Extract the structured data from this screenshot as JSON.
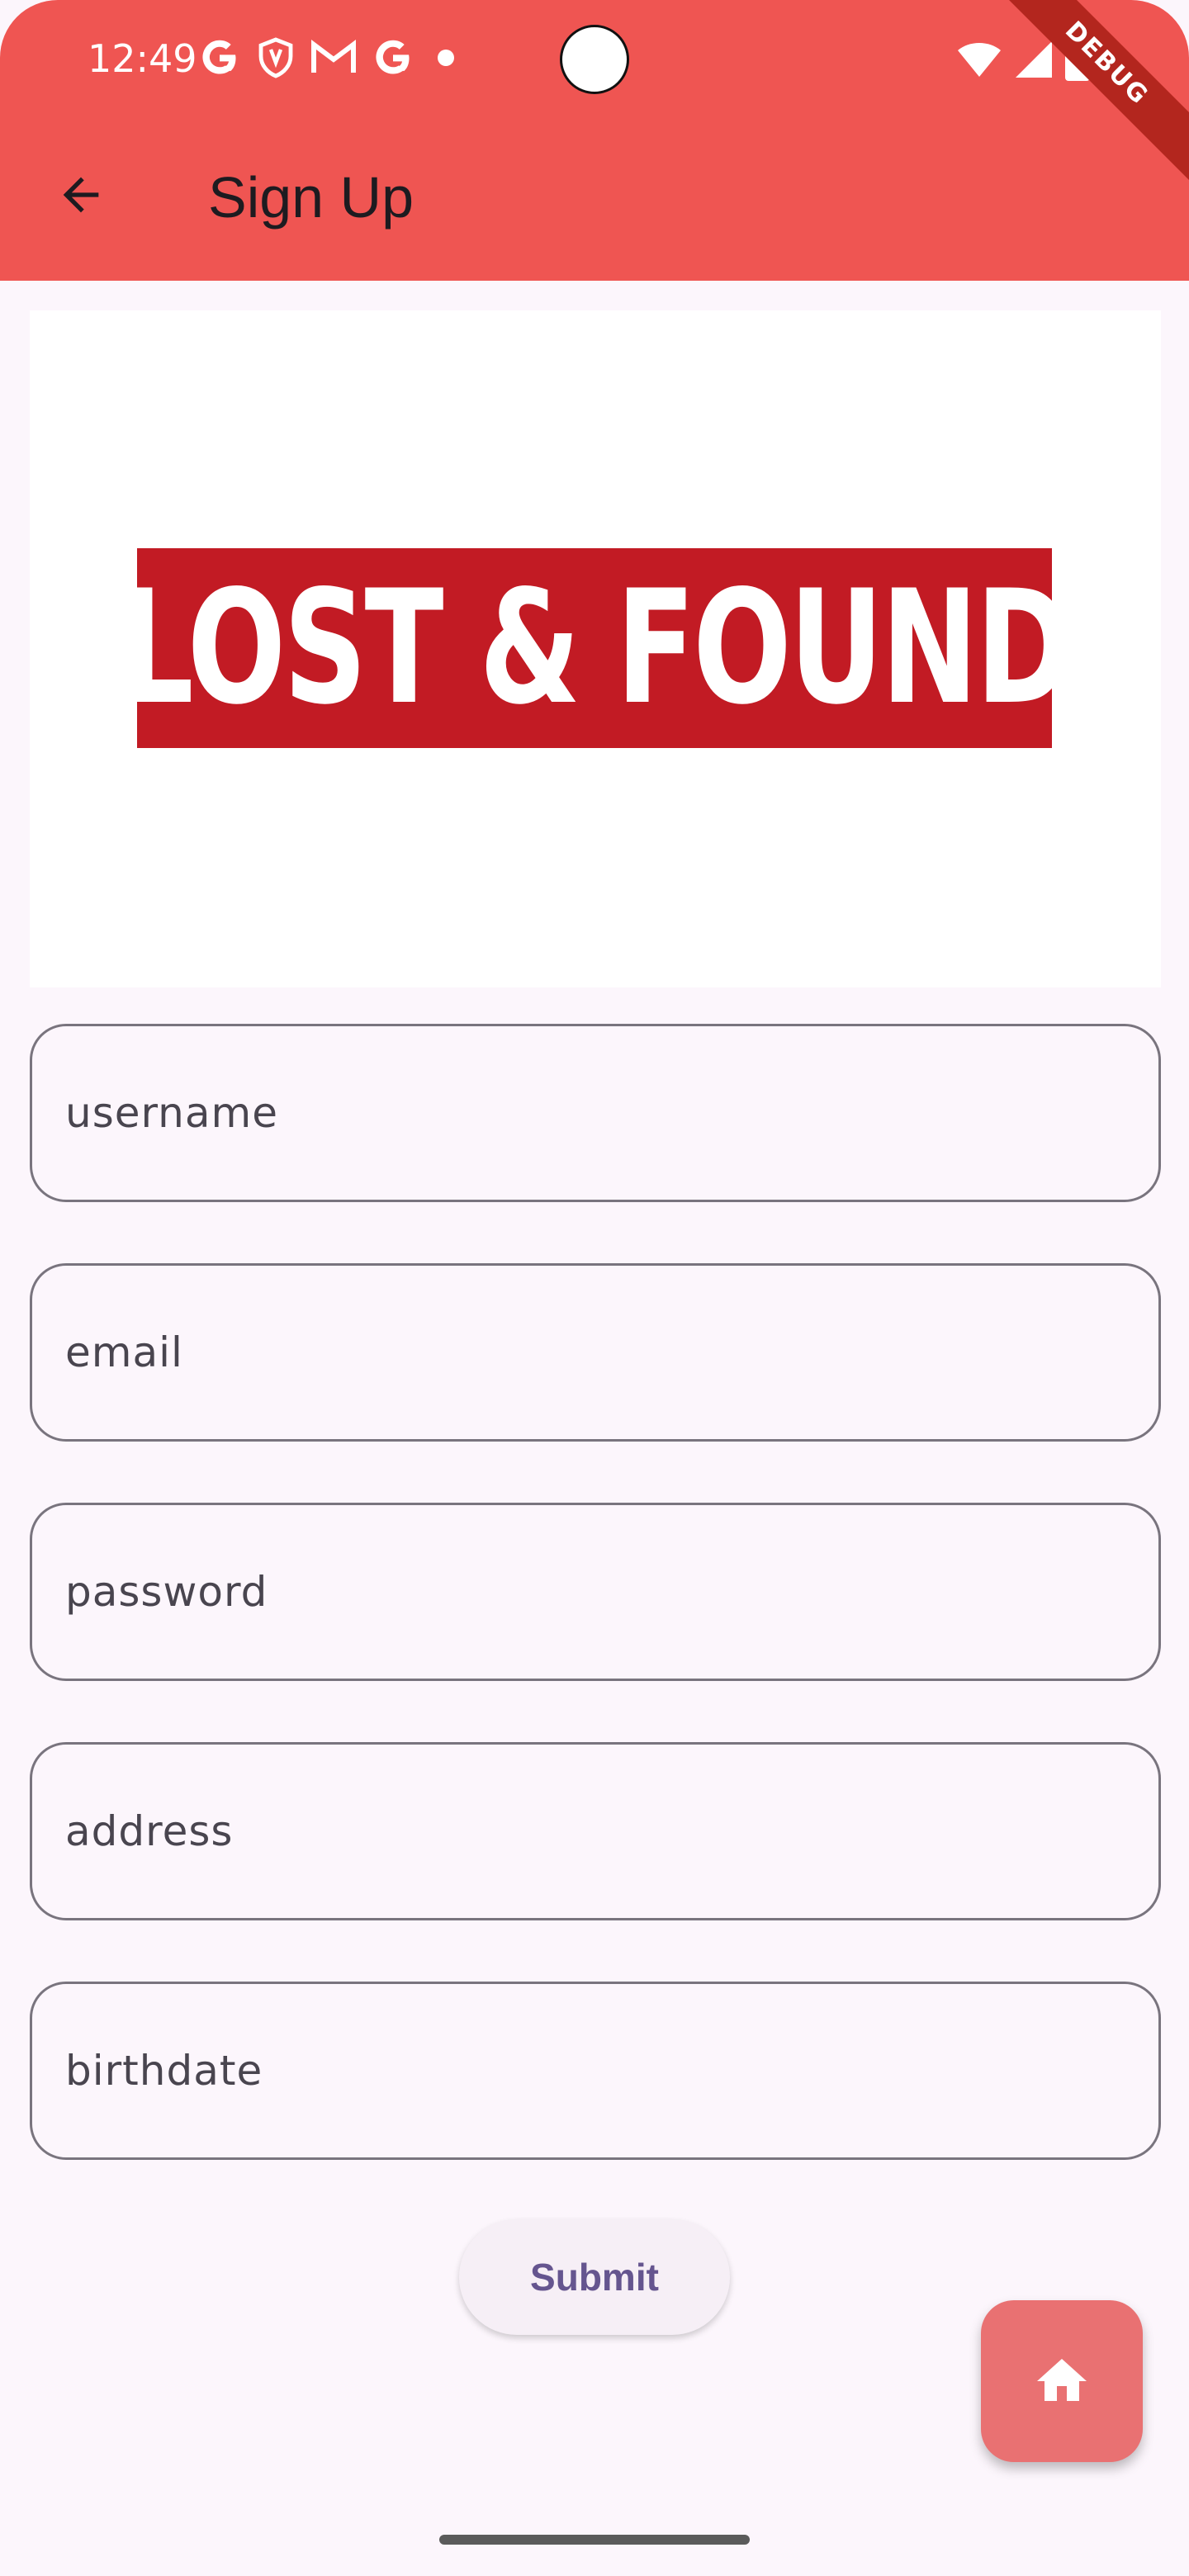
{
  "status_bar": {
    "time": "12:49",
    "icons_left": [
      "google-g-icon",
      "shield-icon",
      "gmail-icon",
      "google-g-icon",
      "dot-icon"
    ],
    "icons_right": [
      "wifi-icon",
      "signal-icon",
      "battery-icon"
    ],
    "debug_label": "DEBUG"
  },
  "app_bar": {
    "title": "Sign Up",
    "background_color": "#ef5552"
  },
  "logo": {
    "text": "LOST & FOUND",
    "banner_color": "#c21b24"
  },
  "form": {
    "fields": [
      {
        "name": "username",
        "placeholder": "username",
        "value": ""
      },
      {
        "name": "email",
        "placeholder": "email",
        "value": ""
      },
      {
        "name": "password",
        "placeholder": "password",
        "value": ""
      },
      {
        "name": "address",
        "placeholder": "address",
        "value": ""
      },
      {
        "name": "birthdate",
        "placeholder": "birthdate",
        "value": ""
      }
    ],
    "submit_label": "Submit"
  },
  "fab": {
    "icon": "home-icon",
    "color": "#e97172"
  }
}
